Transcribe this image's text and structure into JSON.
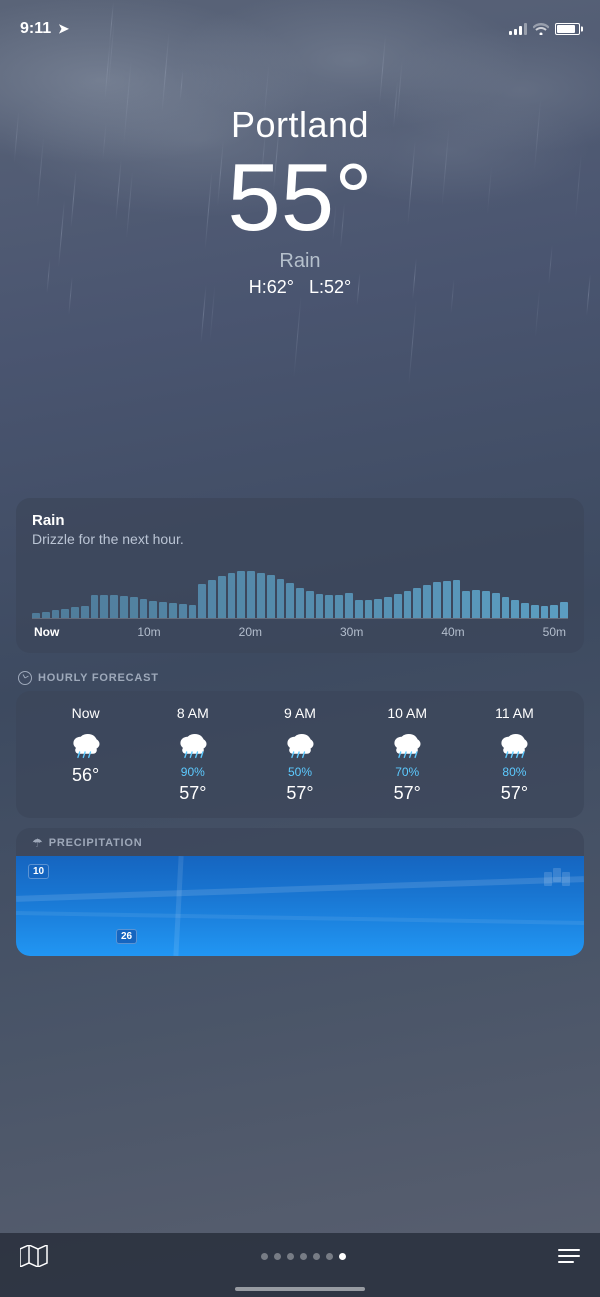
{
  "statusBar": {
    "time": "9:11",
    "showLocation": true
  },
  "weather": {
    "city": "Portland",
    "temperature": "55°",
    "condition": "Rain",
    "high": "H:62°",
    "low": "L:52°"
  },
  "precipCard": {
    "title": "Rain",
    "subtitle": "Drizzle for the next hour.",
    "timeLabels": [
      "Now",
      "10m",
      "20m",
      "30m",
      "40m",
      "50m"
    ]
  },
  "hourlySection": {
    "header": "HOURLY FORECAST",
    "items": [
      {
        "time": "Now",
        "precip": "",
        "temp": "56°"
      },
      {
        "time": "8 AM",
        "precip": "90%",
        "temp": "57°"
      },
      {
        "time": "9 AM",
        "precip": "50%",
        "temp": "57°"
      },
      {
        "time": "10 AM",
        "precip": "70%",
        "temp": "57°"
      },
      {
        "time": "11 AM",
        "precip": "80%",
        "temp": "57°"
      }
    ]
  },
  "precipSection": {
    "header": "PRECIPITATION",
    "mapNumbers": [
      "10",
      "26"
    ]
  },
  "bottomNav": {
    "dots": 7,
    "activeDot": 6
  }
}
